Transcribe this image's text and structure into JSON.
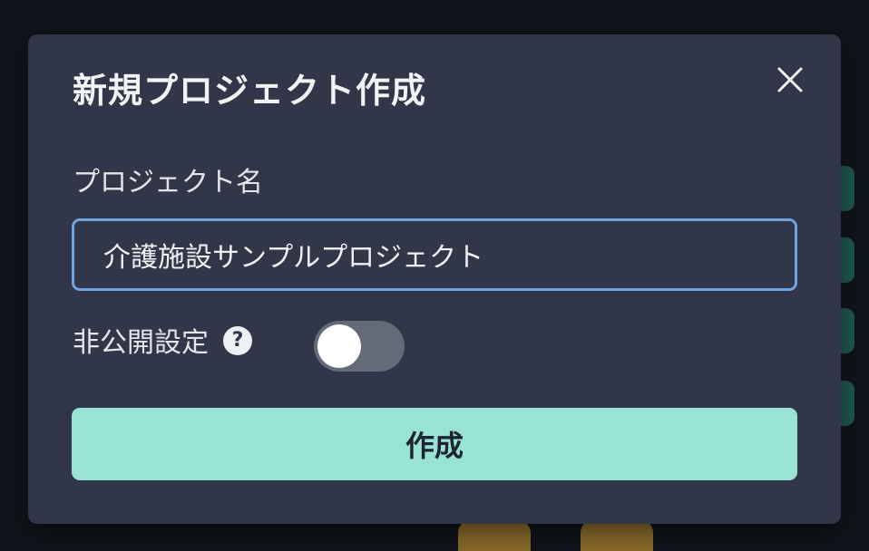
{
  "dialog": {
    "title": "新規プロジェクト作成",
    "close_icon": "close-icon"
  },
  "project_name": {
    "label": "プロジェクト名",
    "value": "介護施設サンプルプロジェクト"
  },
  "privacy": {
    "label": "非公開設定",
    "help_glyph": "?",
    "help_icon": "help-icon",
    "enabled": false
  },
  "actions": {
    "create_label": "作成"
  },
  "colors": {
    "modal_bg": "#313748",
    "input_border": "#6ea4e0",
    "create_button": "#98e2d6",
    "toggle_off": "#646a78"
  }
}
